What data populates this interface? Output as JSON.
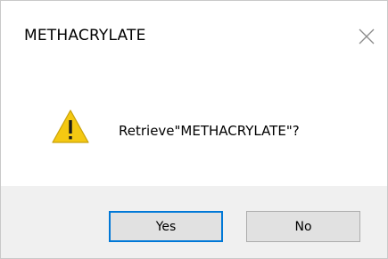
{
  "window": {
    "title": "METHACRYLATE"
  },
  "dialog": {
    "icon": "warning-icon",
    "message": "Retrieve\"METHACRYLATE\"?"
  },
  "buttons": {
    "yes_label": "Yes",
    "no_label": "No"
  },
  "colors": {
    "warning_fill": "#f4c812",
    "default_button_border": "#0078d7",
    "footer_background": "#f0f0f0"
  }
}
